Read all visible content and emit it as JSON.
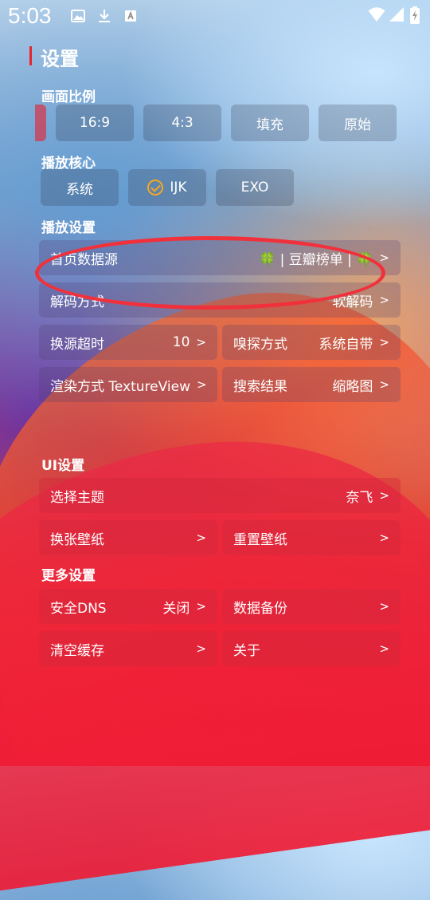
{
  "status_bar": {
    "time": "5:03"
  },
  "page": {
    "title": "设置"
  },
  "aspect": {
    "heading": "画面比例",
    "options": [
      "16:9",
      "4:3",
      "填充",
      "原始"
    ]
  },
  "core": {
    "heading": "播放核心",
    "options": [
      "系统",
      "IJK",
      "EXO"
    ],
    "selected": "IJK"
  },
  "playback": {
    "heading": "播放设置",
    "home_source": {
      "label": "首页数据源",
      "value": "🍀 | 豆瓣榜单 | 🍀"
    },
    "decode": {
      "label": "解码方式",
      "value": "软解码"
    },
    "timeout": {
      "label": "换源超时",
      "value": "10"
    },
    "sniff": {
      "label": "嗅探方式",
      "value": "系统自带"
    },
    "render": {
      "label": "渲染方式 TextureView"
    },
    "search": {
      "label": "搜索结果",
      "value": "缩略图"
    }
  },
  "ui": {
    "heading": "UI设置",
    "theme": {
      "label": "选择主题",
      "value": "奈飞"
    },
    "wallpaper_change": {
      "label": "换张壁纸"
    },
    "wallpaper_reset": {
      "label": "重置壁纸"
    }
  },
  "more": {
    "heading": "更多设置",
    "dns": {
      "label": "安全DNS",
      "value": "关闭"
    },
    "backup": {
      "label": "数据备份"
    },
    "clear_cache": {
      "label": "清空缓存"
    },
    "about": {
      "label": "关于"
    }
  },
  "arrow": ">",
  "colors": {
    "accent": "#e8232f",
    "check": "#f5a623",
    "annotation": "#f0313c"
  }
}
